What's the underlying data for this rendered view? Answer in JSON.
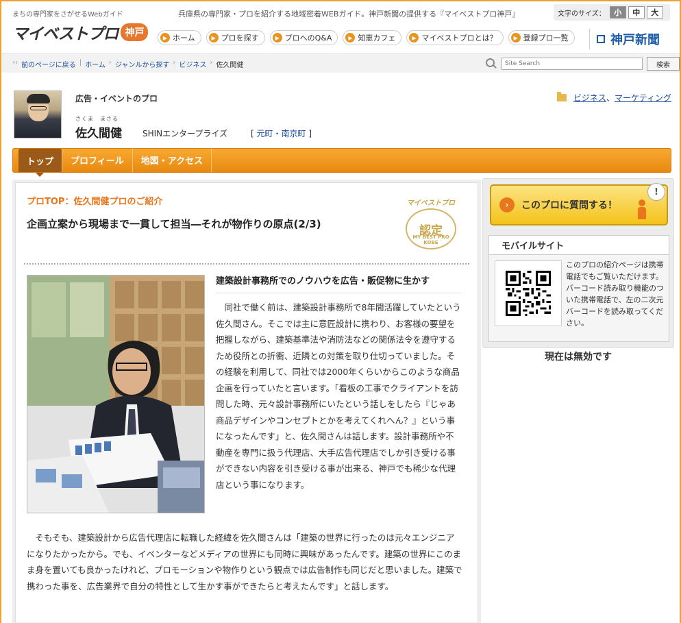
{
  "header": {
    "tagline": "まちの専門家をさがせるWebガイド",
    "logo_main": "マイベストプロ",
    "logo_region": "神戸",
    "site_desc": "兵庫県の専門家・プロを紹介する地域密着WEBガイド。神戸新聞の提供する『マイベストプロ神戸』",
    "fontsize_label": "文字のサイズ：",
    "fontsize_small": "小",
    "fontsize_medium": "中",
    "fontsize_large": "大",
    "nav": [
      "ホーム",
      "プロを探す",
      "プロへのQ&A",
      "知恵カフェ",
      "マイベストプロとは？",
      "登録プロ一覧"
    ],
    "partner": "神戸新聞"
  },
  "breadcrumb": {
    "back": "前のページに戻る",
    "home": "ホーム",
    "genre": "ジャンルから探す",
    "category": "ビジネス",
    "current": "佐久間健",
    "back_prefix": "‹‹"
  },
  "search": {
    "placeholder": "Site Search",
    "button": "検索"
  },
  "profile": {
    "category": "広告・イベントのプロ",
    "ruby": "さくま　まさる",
    "name": "佐久間健",
    "company": "SHINエンタープライズ",
    "area": "元町・南京町",
    "genre_1": "ビジネス",
    "genre_sep": "、",
    "genre_2": "マーケティング"
  },
  "tabs": [
    "トップ",
    "プロフィール",
    "地図・アクセス"
  ],
  "main": {
    "section_title": "プロTOP：佐久間健プロのご紹介",
    "heading": "企画立案から現場まで一貫して担当―それが物作りの原点(2/3)",
    "stamp_top": "マイベストプロ",
    "stamp_main": "認定",
    "stamp_sub": "MY BEST PRO KOBE",
    "subhead": "建築設計事務所でのノウハウを広告・販促物に生かす",
    "para1": "同社で働く前は、建築設計事務所で8年間活躍していたという佐久間さん。そこでは主に意匠設計に携わり、お客様の要望を把握しながら、建築基準法や消防法などの関係法令を遵守するため役所との折衝、近隣との対策を取り仕切っていました。その経験を利用して、同社では2000年くらいからこのような商品企画を行っていたと言います。「看板の工事でクライアントを訪問した時、元々設計事務所にいたという話しをしたら『じゃあ商品デザインやコンセプトとかを考えてくれへん？』という事になったんです」と、佐久間さんは話します。設計事務所や不動産を専門に扱う代理店、大手広告代理店でしか引き受ける事ができない内容を引き受ける事が出来る、神戸でも稀少な代理店という事になります。",
    "para2": "そもそも、建築設計から広告代理店に転職した経緯を佐久間さんは「建築の世界に行ったのは元々エンジニアになりたかったから。でも、イベンターなどメディアの世界にも同時に興味があったんです。建築の世界にこのまま身を置いても良かったけれど、プロモーションや物作りという観点では広告制作も同じだと思いました。建築で携わった事を、広告業界で自分の特性として生かす事ができたらと考えたんです」と話します。"
  },
  "sidebar": {
    "ask_label": "このプロに質問する！",
    "ask_bang": "!",
    "mobile_title": "モバイルサイト",
    "mobile_text": "このプロの紹介ページは携帯電話でもご覧いただけます。 バーコード読み取り機能のついた携帯電話で、左の二次元バーコードを読み取ってください。",
    "disabled_note": "現在は無効です"
  },
  "colors": {
    "accent_orange": "#e8890f",
    "link_blue": "#1a4fa0",
    "partner_blue": "#1a5ba6"
  }
}
